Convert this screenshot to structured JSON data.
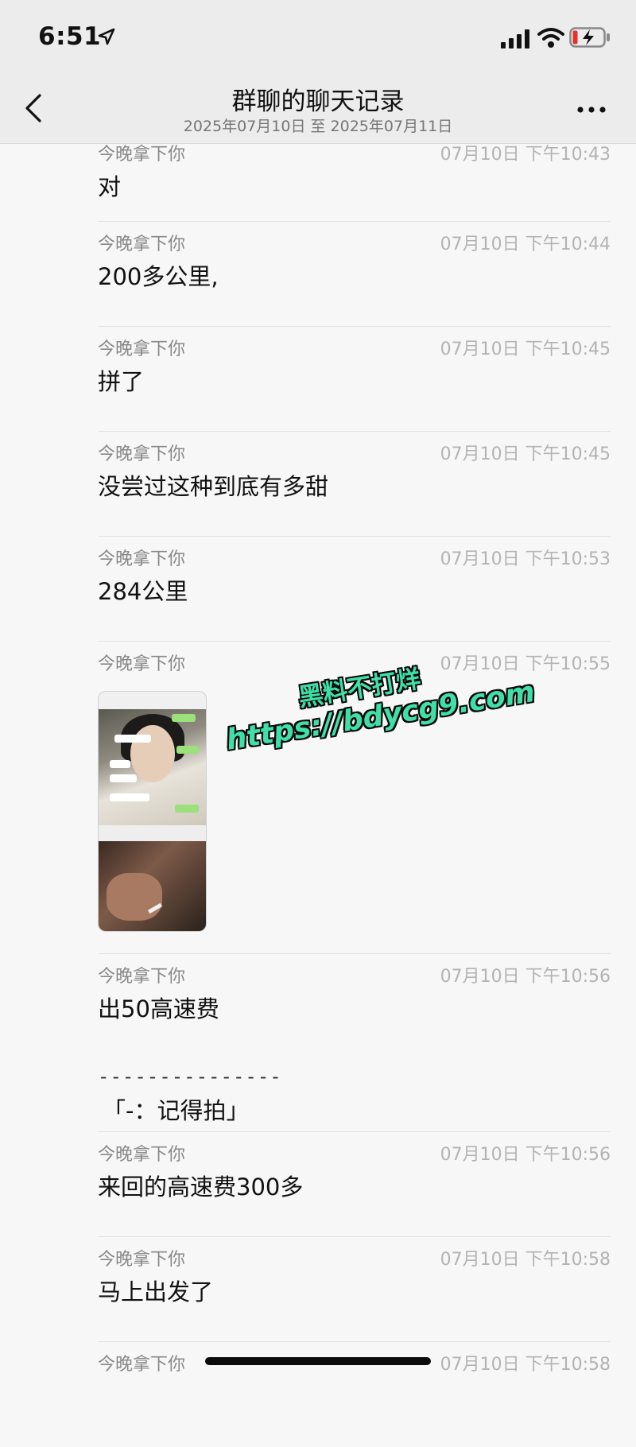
{
  "status_bar": {
    "time": "6:51"
  },
  "header": {
    "title": "群聊的聊天记录",
    "subtitle": "2025年07月10日 至 2025年07月11日"
  },
  "messages": [
    {
      "sender": "今晚拿下你",
      "stamp": "07月10日 下午10:43",
      "text": "对"
    },
    {
      "sender": "今晚拿下你",
      "stamp": "07月10日 下午10:44",
      "text": "200多公里,"
    },
    {
      "sender": "今晚拿下你",
      "stamp": "07月10日 下午10:45",
      "text": "拼了"
    },
    {
      "sender": "今晚拿下你",
      "stamp": "07月10日 下午10:45",
      "text": "没尝过这种到底有多甜"
    },
    {
      "sender": "今晚拿下你",
      "stamp": "07月10日 下午10:53",
      "text": "284公里"
    },
    {
      "sender": "今晚拿下你",
      "stamp": "07月10日 下午10:55",
      "text": ""
    },
    {
      "sender": "今晚拿下你",
      "stamp": "07月10日 下午10:56",
      "text": "出50高速费",
      "separator": "---------------",
      "quote": "「-：记得拍」"
    },
    {
      "sender": "今晚拿下你",
      "stamp": "07月10日 下午10:56",
      "text": "来回的高速费300多"
    },
    {
      "sender": "今晚拿下你",
      "stamp": "07月10日 下午10:58",
      "text": "马上出发了"
    },
    {
      "sender": "今晚拿下你",
      "stamp": "07月10日 下午10:58",
      "text": ""
    }
  ],
  "watermark": {
    "line1": "黑料不打烊",
    "line2": "https://bdycg9.com"
  }
}
